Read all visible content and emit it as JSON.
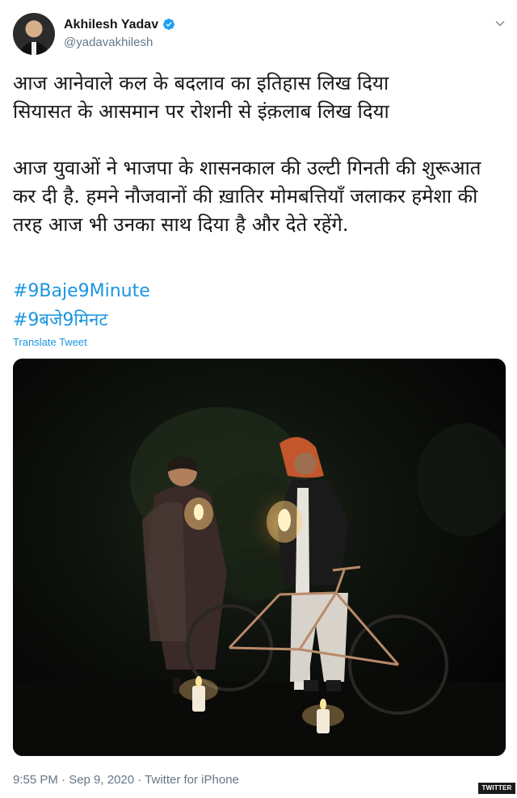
{
  "author": {
    "display_name": "Akhilesh Yadav",
    "handle": "@yadavakhilesh",
    "verified": true
  },
  "tweet": {
    "body": "आज आनेवाले कल के बदलाव का इतिहास लिख दिया\nसियासत के आसमान पर रोशनी से इंक़लाब लिख दिया\n\nआज युवाओं ने भाजपा के शासनकाल की उल्टी गिनती की शुरूआत कर दी है. हमने नौजवानों की ख़ातिर मोमबत्तियाँ जलाकर हमेशा की तरह आज भी उनका साथ दिया है और देते रहेंगे.",
    "hashtags": [
      "#9Baje9Minute",
      "#9बजे9मिनट"
    ],
    "translate_label": "Translate Tweet",
    "timestamp": "9:55 PM · Sep 9, 2020 · Twitter for iPhone"
  },
  "colors": {
    "link": "#1b95e0",
    "secondary_text": "#657786",
    "verified_badge": "#1da1f2"
  },
  "icons": {
    "verified": "verified-badge-icon",
    "more": "chevron-down-icon"
  },
  "watermark": "TWITTER"
}
